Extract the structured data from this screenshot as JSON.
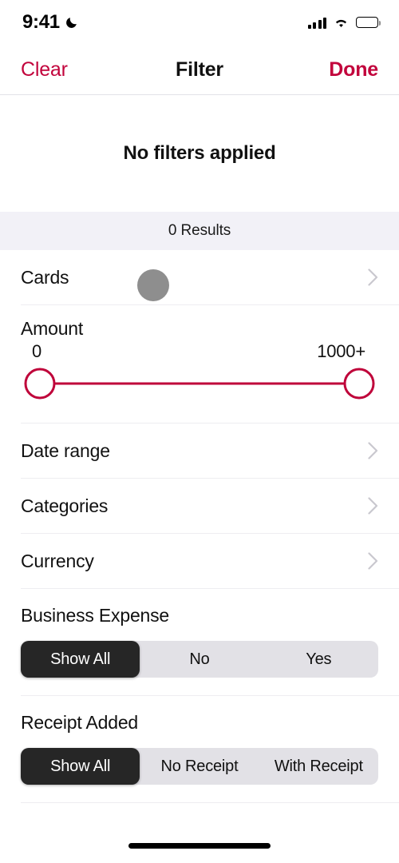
{
  "status_bar": {
    "time": "9:41",
    "moon_icon": "crescent-moon-icon",
    "signal_icon": "cellular-bars-icon",
    "wifi_icon": "wifi-icon",
    "battery_icon": "battery-full-icon"
  },
  "nav": {
    "clear_label": "Clear",
    "title": "Filter",
    "done_label": "Done",
    "accent_color": "#c2043c"
  },
  "empty_state": {
    "message": "No filters applied"
  },
  "results": {
    "text": "0 Results",
    "band_color": "#f2f1f7"
  },
  "rows": [
    {
      "label": "Cards",
      "chevron": "chevron-right-icon"
    },
    {
      "label": "Date range",
      "chevron": "chevron-right-icon"
    },
    {
      "label": "Categories",
      "chevron": "chevron-right-icon"
    },
    {
      "label": "Currency",
      "chevron": "chevron-right-icon"
    }
  ],
  "amount": {
    "title": "Amount",
    "min_label": "0",
    "max_label": "1000+",
    "min_value": 0,
    "max_value": 1000,
    "track_color": "#bf043a"
  },
  "business_expense": {
    "title": "Business Expense",
    "options": [
      "Show All",
      "No",
      "Yes"
    ],
    "selected_index": 0
  },
  "receipt_added": {
    "title": "Receipt Added",
    "options": [
      "Show All",
      "No Receipt",
      "With Receipt"
    ],
    "selected_index": 0
  },
  "cursor": {
    "name": "touch-indicator",
    "color": "#8e8e8e"
  },
  "home_indicator": {
    "name": "home-indicator"
  }
}
